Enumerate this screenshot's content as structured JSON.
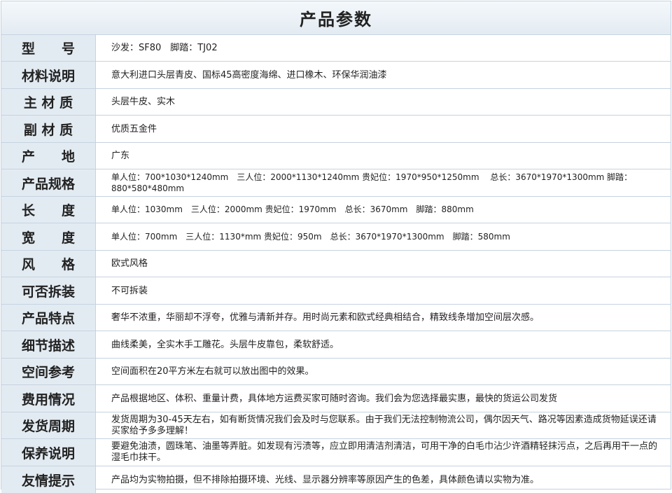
{
  "title": "产品参数",
  "rows": [
    {
      "label": "型　　号",
      "value": "沙发：SF80　脚踏：TJ02"
    },
    {
      "label": "材料说明",
      "value": "意大利进口头层青皮、国标45高密度海绵、进口橡木、环保华润油漆"
    },
    {
      "label": "主 材 质",
      "value": "头层牛皮、实木"
    },
    {
      "label": "副 材 质",
      "value": "优质五金件"
    },
    {
      "label": "产　　地",
      "value": "广东"
    },
    {
      "label": "产品规格",
      "value": "单人位：700*1030*1240mm　三人位：2000*1130*1240mm 贵妃位：1970*950*1250mm　 总长：3670*1970*1300mm 脚踏：880*580*480mm"
    },
    {
      "label": "长　　度",
      "value": "单人位：1030mm　三人位：2000mm 贵妃位：1970mm　总长：3670mm　脚踏：880mm"
    },
    {
      "label": "宽　　度",
      "value": "单人位：700mm　三人位：1130*mm 贵妃位：950m　总长：3670*1970*1300mm　脚踏：580mm"
    },
    {
      "label": "风　　格",
      "value": "欧式风格"
    },
    {
      "label": "可否拆装",
      "value": "不可拆装"
    },
    {
      "label": "产品特点",
      "value": "奢华不浓重，华丽却不浮夸，优雅与清新并存。用时尚元素和欧式经典相结合，精致线条增加空间层次感。"
    },
    {
      "label": "细节描述",
      "value": "曲线柔美，全实木手工雕花。头层牛皮靠包，柔软舒适。"
    },
    {
      "label": "空间参考",
      "value": "空间面积在20平方米左右就可以放出图中的效果。"
    },
    {
      "label": "费用情况",
      "value": "产品根据地区、体积、重量计费，具体地方运费买家可随时咨询。我们会为您选择最实惠，最快的货运公司发货"
    },
    {
      "label": "发货周期",
      "value": "发货周期为30-45天左右，如有断货情况我们会及时与您联系。由于我们无法控制物流公司，偶尔因天气、路况等因素造成货物延误还请买家给予多多理解！"
    },
    {
      "label": "保养说明",
      "value": "要避免油渍，圆珠笔、油墨等弄脏。如发现有污渍等，应立即用清洁剂清洁，可用干净的白毛巾沾少许酒精轻抹污点，之后再用干一点的湿毛巾抹干。"
    },
    {
      "label": "友情提示",
      "value": "产品均为实物拍摄，但不排除拍摄环境、光线、显示器分辨率等原因产生的色差，具体颜色请以实物为准。"
    }
  ]
}
